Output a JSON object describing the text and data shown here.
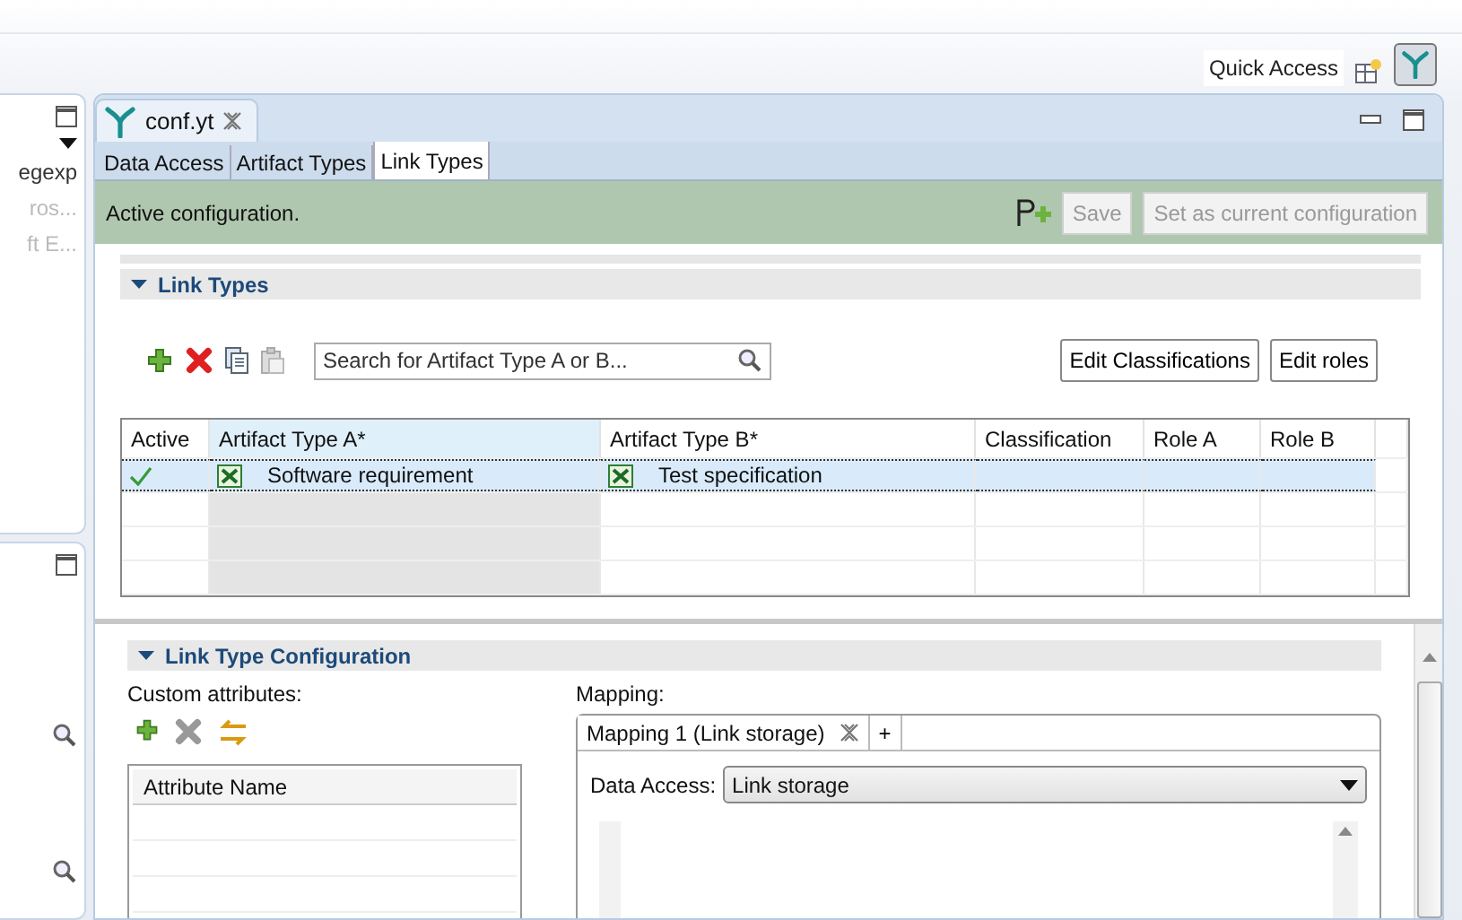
{
  "toolbar": {
    "quick_access": "Quick Access"
  },
  "left_panel": {
    "items": [
      "egexp",
      "ros...",
      "ft E..."
    ]
  },
  "editor": {
    "tabs": [
      {
        "label": "conf.yt",
        "selected": true
      }
    ],
    "pages": [
      {
        "label": "Data Access",
        "selected": false
      },
      {
        "label": "Artifact Types",
        "selected": false
      },
      {
        "label": "Link Types",
        "selected": true
      }
    ],
    "status": {
      "message": "Active configuration.",
      "buttons": [
        {
          "label": "Save",
          "disabled": true
        },
        {
          "label": "Set as current configuration",
          "disabled": true
        }
      ]
    },
    "link_types": {
      "title": "Link Types",
      "expanded": true,
      "search": {
        "placeholder": "Search for Artifact Type A or B..."
      },
      "buttons": [
        "Edit Classifications",
        "Edit roles"
      ],
      "table": {
        "columns": [
          "Active",
          "Artifact Type A*",
          "Artifact Type B*",
          "Classification",
          "Role A",
          "Role B"
        ],
        "rows": [
          {
            "active": true,
            "selected": true,
            "artifact_type_a": "Software requirement",
            "artifact_type_b": "Test specification"
          }
        ]
      }
    },
    "link_type_configuration": {
      "title": "Link Type Configuration",
      "expanded": true,
      "custom_attributes": {
        "label": "Custom attributes:",
        "columns": [
          "Attribute Name"
        ]
      },
      "mapping": {
        "label": "Mapping:",
        "tabs": [
          {
            "label": "Mapping 1 (Link storage)",
            "selected": true
          }
        ],
        "add_tab": "+",
        "data_access": {
          "label": "Data Access:",
          "value": "Link storage"
        }
      }
    }
  }
}
